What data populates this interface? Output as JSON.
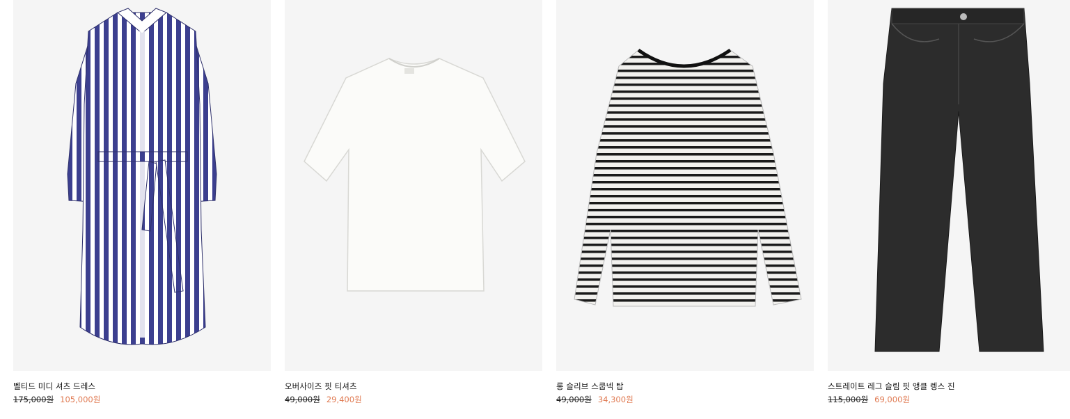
{
  "colors": {
    "sale_price": "#e07a52",
    "image_bg": "#f5f5f5"
  },
  "products": [
    {
      "name": "벨티드 미디 셔츠 드레스",
      "original_price": "175,000원",
      "sale_price": "105,000원",
      "image": "striped-shirt-dress-image"
    },
    {
      "name": "오버사이즈 핏 티셔츠",
      "original_price": "49,000원",
      "sale_price": "29,400원",
      "image": "white-tshirt-image"
    },
    {
      "name": "롱 슬리브 스쿱넥 탑",
      "original_price": "49,000원",
      "sale_price": "34,300원",
      "image": "striped-long-sleeve-top-image"
    },
    {
      "name": "스트레이트 레그 슬림 핏 앵클 렝스 진",
      "original_price": "115,000원",
      "sale_price": "69,000원",
      "image": "black-jeans-image"
    }
  ]
}
